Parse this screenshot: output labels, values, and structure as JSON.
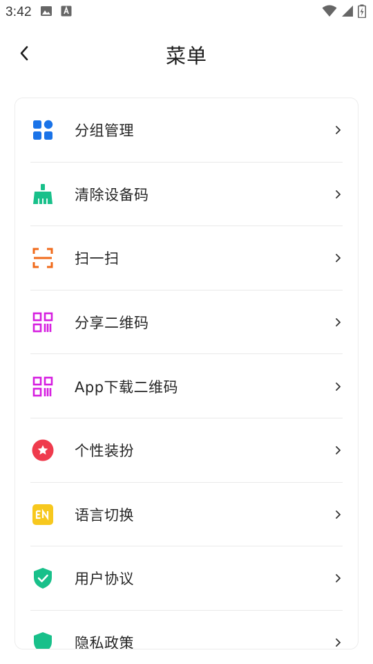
{
  "status_bar": {
    "time": "3:42"
  },
  "header": {
    "title": "菜单"
  },
  "menu": {
    "items": [
      {
        "label": "分组管理",
        "icon": "grid-icon",
        "color": "#1a73e8"
      },
      {
        "label": "清除设备码",
        "icon": "broom-icon",
        "color": "#18c08a"
      },
      {
        "label": "扫一扫",
        "icon": "scan-icon",
        "color": "#f06a1a"
      },
      {
        "label": "分享二维码",
        "icon": "qrcode-icon",
        "color": "#d61ee0"
      },
      {
        "label": "App下载二维码",
        "icon": "qrcode-icon",
        "color": "#d61ee0"
      },
      {
        "label": "个性装扮",
        "icon": "star-badge-icon",
        "color": "#ef3b4d"
      },
      {
        "label": "语言切换",
        "icon": "language-en-icon",
        "color": "#f7c81e"
      },
      {
        "label": "用户协议",
        "icon": "shield-check-icon",
        "color": "#18c08a"
      },
      {
        "label": "隐私政策",
        "icon": "shield-icon",
        "color": "#18c08a"
      }
    ]
  }
}
